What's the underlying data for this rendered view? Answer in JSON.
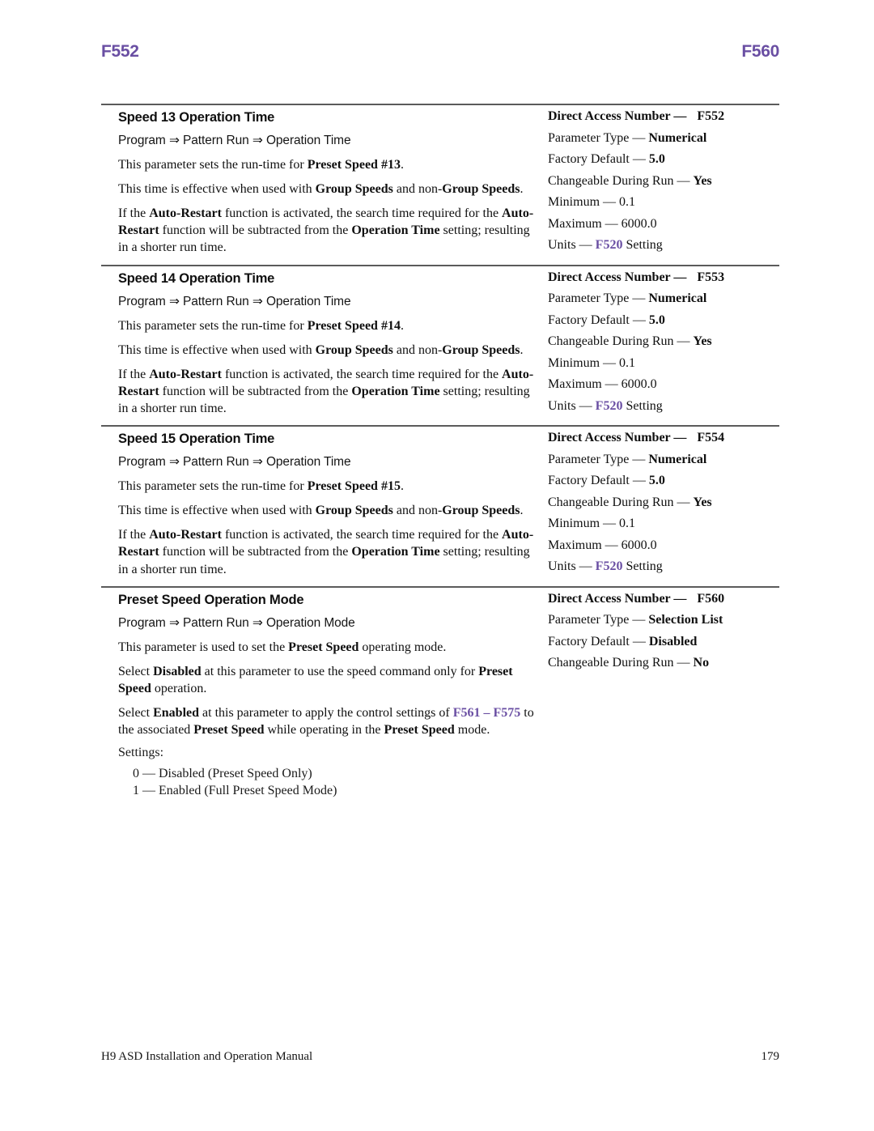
{
  "running_header": {
    "left": "F552",
    "right": "F560",
    "color": "#6a4fa3"
  },
  "sections": [
    {
      "title": "Speed 13 Operation Time",
      "breadcrumb": "Program ⇒ Pattern Run ⇒ Operation Time",
      "paragraphs": [
        "This parameter sets the run-time for Preset Speed #13.",
        "This time is effective when used with Group Speeds and non-Group Speeds.",
        "If the Auto-Restart function is activated, the search time required for the Auto-Restart function will be subtracted from the Operation Time setting; resulting in a shorter run time."
      ],
      "specs": [
        {
          "label": "Direct Access Number",
          "value": "F552"
        },
        {
          "label": "Parameter Type",
          "value": "Numerical"
        },
        {
          "label": "Factory Default",
          "value": "5.0"
        },
        {
          "label": "Changeable During Run",
          "value": "Yes"
        },
        {
          "label": "Minimum",
          "value": "0.1"
        },
        {
          "label": "Maximum",
          "value": "6000.0"
        },
        {
          "label": "Units",
          "value": "F520 Setting"
        }
      ]
    },
    {
      "title": "Speed 14 Operation Time",
      "breadcrumb": "Program ⇒ Pattern Run ⇒ Operation Time",
      "paragraphs": [
        "This parameter sets the run-time for Preset Speed #14.",
        "This time is effective when used with Group Speeds and non-Group Speeds.",
        "If the Auto-Restart function is activated, the search time required for the Auto-Restart function will be subtracted from the Operation Time setting; resulting in a shorter run time."
      ],
      "specs": [
        {
          "label": "Direct Access Number",
          "value": "F553"
        },
        {
          "label": "Parameter Type",
          "value": "Numerical"
        },
        {
          "label": "Factory Default",
          "value": "5.0"
        },
        {
          "label": "Changeable During Run",
          "value": "Yes"
        },
        {
          "label": "Minimum",
          "value": "0.1"
        },
        {
          "label": "Maximum",
          "value": "6000.0"
        },
        {
          "label": "Units",
          "value": "F520 Setting"
        }
      ]
    },
    {
      "title": "Speed 15 Operation Time",
      "breadcrumb": "Program ⇒ Pattern Run ⇒ Operation Time",
      "paragraphs": [
        "This parameter sets the run-time for Preset Speed #15.",
        "This time is effective when used with Group Speeds and non-Group Speeds.",
        "If the Auto-Restart function is activated, the search time required for the Auto-Restart function will be subtracted from the Operation Time setting; resulting in a shorter run time."
      ],
      "specs": [
        {
          "label": "Direct Access Number",
          "value": "F554"
        },
        {
          "label": "Parameter Type",
          "value": "Numerical"
        },
        {
          "label": "Factory Default",
          "value": "5.0"
        },
        {
          "label": "Changeable During Run",
          "value": "Yes"
        },
        {
          "label": "Minimum",
          "value": "0.1"
        },
        {
          "label": "Maximum",
          "value": "6000.0"
        },
        {
          "label": "Units",
          "value": "F520 Setting"
        }
      ]
    },
    {
      "title": "Preset Speed Operation Mode",
      "breadcrumb": "Program ⇒ Pattern Run ⇒ Operation Mode",
      "paragraphs": [
        "This parameter is used to set the Preset Speed operating mode.",
        "Select Disabled at this parameter to use the speed command only for Preset Speed operation.",
        "Select Enabled at this parameter to apply the control settings of F561 – F575 to the associated Preset Speed while operating in the Preset Speed mode."
      ],
      "settings_label": "Settings:",
      "settings": [
        "0 — Disabled (Preset Speed Only)",
        "1 — Enabled (Full Preset Speed Mode)"
      ],
      "specs": [
        {
          "label": "Direct Access Number",
          "value": "F560"
        },
        {
          "label": "Parameter Type",
          "value": "Selection List"
        },
        {
          "label": "Factory Default",
          "value": "Disabled"
        },
        {
          "label": "Changeable During Run",
          "value": "No"
        }
      ]
    }
  ],
  "footer": {
    "manual_title": "H9 ASD Installation and Operation Manual",
    "page_number": "179"
  }
}
